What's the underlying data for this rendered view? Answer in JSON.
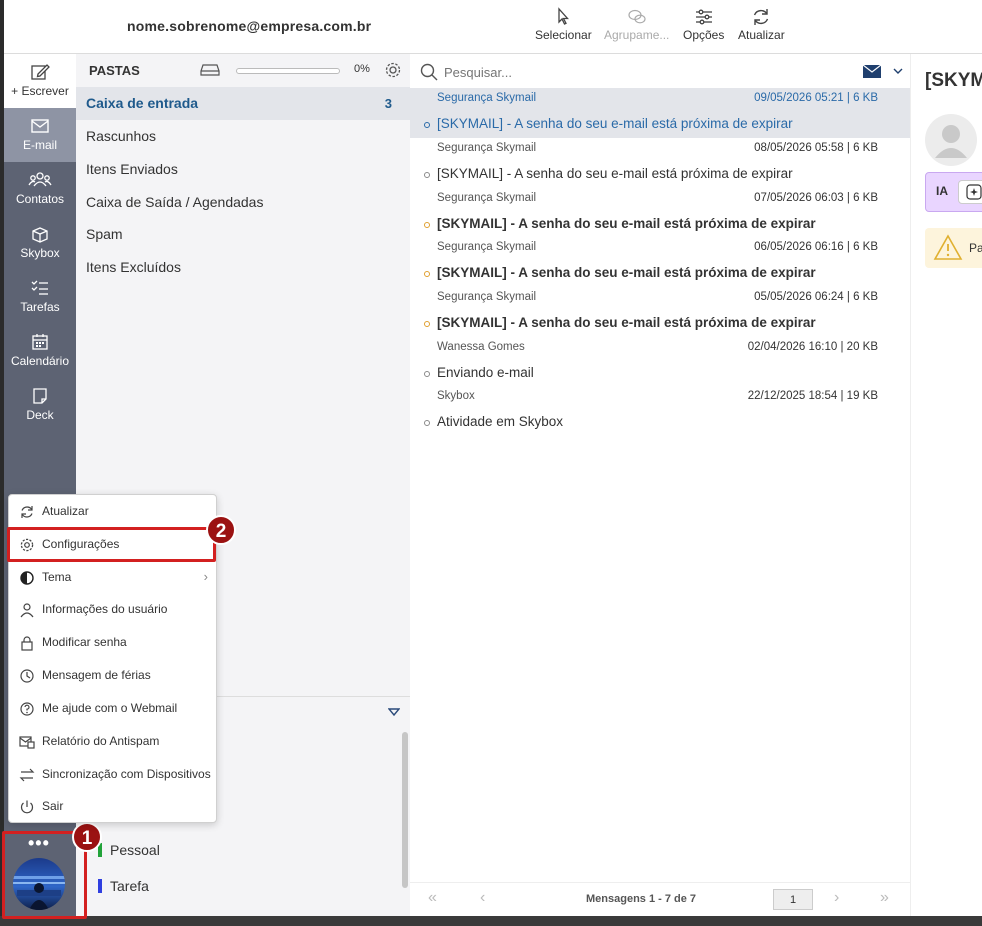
{
  "header": {
    "user_email": "nome.sobrenome@empresa.com.br",
    "tools": [
      {
        "label": "Selecionar",
        "icon": "cursor-icon"
      },
      {
        "label": "Agrupame...",
        "icon": "chat-bubbles-icon",
        "disabled": true
      },
      {
        "label": "Opções",
        "icon": "sliders-icon"
      },
      {
        "label": "Atualizar",
        "icon": "refresh-icon"
      }
    ]
  },
  "nav": {
    "compose": "+ Escrever",
    "items": [
      {
        "label": "E-mail",
        "icon": "mail-icon",
        "active": true
      },
      {
        "label": "Contatos",
        "icon": "contacts-icon"
      },
      {
        "label": "Skybox",
        "icon": "box-icon"
      },
      {
        "label": "Tarefas",
        "icon": "tasks-icon"
      },
      {
        "label": "Calendário",
        "icon": "calendar-icon"
      },
      {
        "label": "Deck",
        "icon": "deck-icon"
      }
    ]
  },
  "folders": {
    "title": "PASTAS",
    "quota_percent": "0%",
    "items": [
      {
        "label": "Caixa de entrada",
        "count": "3",
        "active": true
      },
      {
        "label": "Rascunhos"
      },
      {
        "label": "Itens Enviados"
      },
      {
        "label": "Caixa de Saída / Agendadas"
      },
      {
        "label": "Spam"
      },
      {
        "label": "Itens Excluídos"
      }
    ],
    "tags": [
      {
        "label": "Pessoal",
        "color": "#22a33a"
      },
      {
        "label": "Tarefa",
        "color": "#2f3fe0"
      }
    ]
  },
  "messages": {
    "search_placeholder": "Pesquisar...",
    "list": [
      {
        "from": "Segurança Skymail",
        "meta": "09/05/2026 05:21 | 6 KB",
        "subject": "[SKYMAIL] - A senha do seu e-mail está próxima de expirar",
        "selected": true,
        "unread": false
      },
      {
        "from": "Segurança Skymail",
        "meta": "08/05/2026 05:58 | 6 KB",
        "subject": "[SKYMAIL] - A senha do seu e-mail está próxima de expirar",
        "unread": false
      },
      {
        "from": "Segurança Skymail",
        "meta": "07/05/2026 06:03 | 6 KB",
        "subject": "[SKYMAIL] - A senha do seu e-mail está próxima de expirar",
        "unread": true
      },
      {
        "from": "Segurança Skymail",
        "meta": "06/05/2026 06:16 | 6 KB",
        "subject": "[SKYMAIL] - A senha do seu e-mail está próxima de expirar",
        "unread": true
      },
      {
        "from": "Segurança Skymail",
        "meta": "05/05/2026 06:24 | 6 KB",
        "subject": "[SKYMAIL] - A senha do seu e-mail está próxima de expirar",
        "unread": true
      },
      {
        "from": "Wanessa Gomes",
        "meta": "02/04/2026 16:10 | 20 KB",
        "subject": "Enviando e-mail",
        "unread": false
      },
      {
        "from": "Skybox",
        "meta": "22/12/2025 18:54 | 19 KB",
        "subject": "Atividade em Skybox",
        "unread": false
      }
    ],
    "pager_label": "Mensagens 1 - 7 de 7",
    "current_page": "1"
  },
  "reading": {
    "title": "[SKYM",
    "ia_label": "IA",
    "warning_text": "Pa"
  },
  "menu": {
    "items": [
      {
        "label": "Atualizar",
        "icon": "refresh-icon"
      },
      {
        "label": "Configurações",
        "icon": "gear-icon"
      },
      {
        "label": "Tema",
        "icon": "half-circle-icon",
        "submenu": true
      },
      {
        "label": "Informações do usuário",
        "icon": "user-icon"
      },
      {
        "label": "Modificar senha",
        "icon": "lock-icon"
      },
      {
        "label": "Mensagem de férias",
        "icon": "clock-icon"
      },
      {
        "label": "Me ajude com o Webmail",
        "icon": "help-icon"
      },
      {
        "label": "Relatório do Antispam",
        "icon": "antispam-icon"
      },
      {
        "label": "Sincronização com Dispositivos",
        "icon": "sync-icon"
      },
      {
        "label": "Sair",
        "icon": "power-icon"
      }
    ]
  },
  "annotations": {
    "badge1": "1",
    "badge2": "2"
  },
  "colors": {
    "nav_bg": "#5d6373",
    "nav_active": "#8e94a4",
    "accent": "#1f5a8c",
    "highlight": "#d32020"
  }
}
